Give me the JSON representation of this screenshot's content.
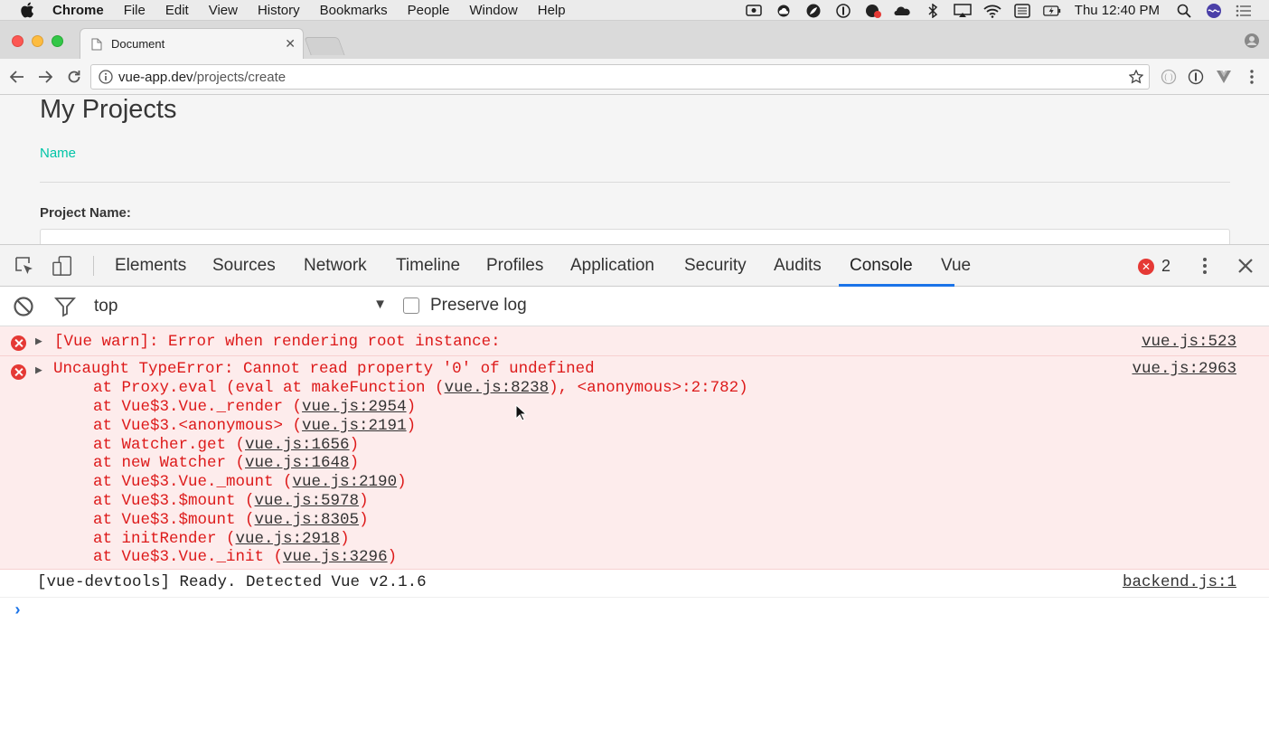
{
  "menubar": {
    "app_name": "Chrome",
    "items": [
      "File",
      "Edit",
      "View",
      "History",
      "Bookmarks",
      "People",
      "Window",
      "Help"
    ],
    "clock": "Thu 12:40 PM"
  },
  "browser": {
    "tab_title": "Document",
    "url_host": "vue-app.dev",
    "url_path": "/projects/create"
  },
  "page": {
    "title": "My Projects",
    "tab_label": "Name",
    "field_label": "Project Name:"
  },
  "devtools": {
    "tabs": [
      "Elements",
      "Sources",
      "Network",
      "Timeline",
      "Profiles",
      "Application",
      "Security",
      "Audits",
      "Console",
      "Vue"
    ],
    "active_tab": "Console",
    "error_count": "2",
    "context": "top",
    "preserve_log_label": "Preserve log",
    "preserve_log_checked": false
  },
  "console": {
    "messages": [
      {
        "level": "error",
        "text": "[Vue warn]: Error when rendering root instance:",
        "source": "vue.js:523"
      },
      {
        "level": "error",
        "text": "Uncaught TypeError: Cannot read property '0' of undefined",
        "source": "vue.js:2963",
        "stack": [
          {
            "prefix": "at Proxy.eval (eval at makeFunction (",
            "link": "vue.js:8238",
            "suffix": "), <anonymous>:2:782)"
          },
          {
            "prefix": "at Vue$3.Vue._render (",
            "link": "vue.js:2954",
            "suffix": ")"
          },
          {
            "prefix": "at Vue$3.<anonymous> (",
            "link": "vue.js:2191",
            "suffix": ")"
          },
          {
            "prefix": "at Watcher.get (",
            "link": "vue.js:1656",
            "suffix": ")"
          },
          {
            "prefix": "at new Watcher (",
            "link": "vue.js:1648",
            "suffix": ")"
          },
          {
            "prefix": "at Vue$3.Vue._mount (",
            "link": "vue.js:2190",
            "suffix": ")"
          },
          {
            "prefix": "at Vue$3.$mount (",
            "link": "vue.js:5978",
            "suffix": ")"
          },
          {
            "prefix": "at Vue$3.$mount (",
            "link": "vue.js:8305",
            "suffix": ")"
          },
          {
            "prefix": "at initRender (",
            "link": "vue.js:2918",
            "suffix": ")"
          },
          {
            "prefix": "at Vue$3.Vue._init (",
            "link": "vue.js:3296",
            "suffix": ")"
          }
        ]
      },
      {
        "level": "log",
        "text": "[vue-devtools] Ready. Detected Vue v2.1.6",
        "source": "backend.js:1"
      }
    ],
    "prompt": "›"
  }
}
